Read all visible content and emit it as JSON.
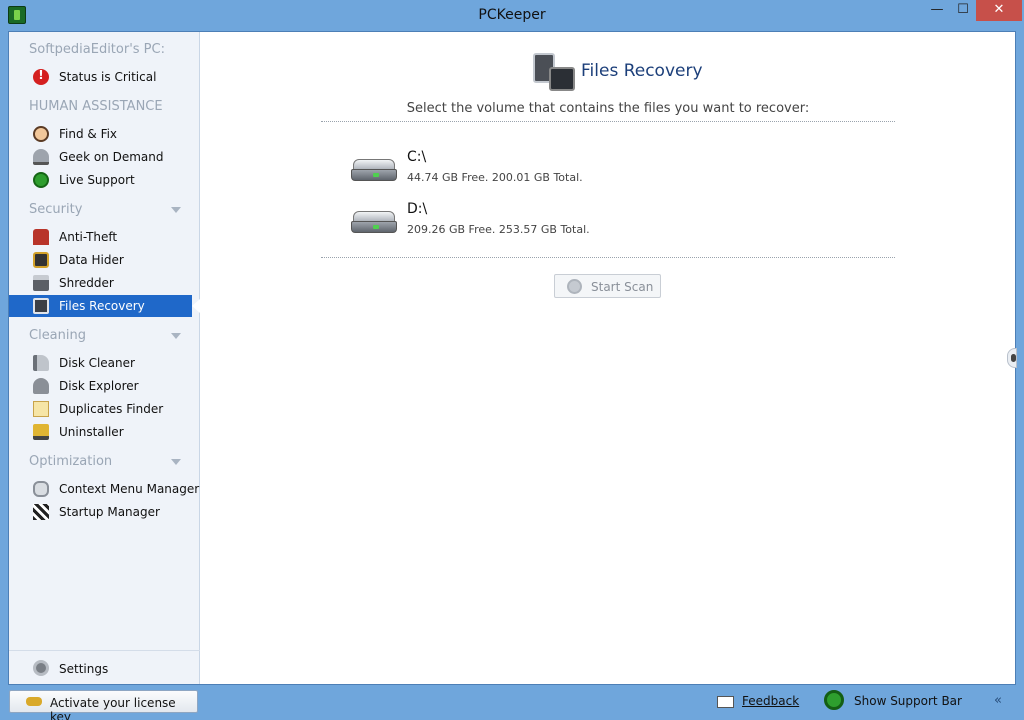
{
  "window": {
    "title": "PCKeeper",
    "minimize_glyph": "—",
    "maximize_glyph": "☐",
    "close_glyph": "✕"
  },
  "sidebar": {
    "pc_header": "SoftpediaEditor's PC:",
    "status_item": {
      "label": "Status is Critical",
      "icon": "critical-icon"
    },
    "human_header": "HUMAN ASSISTANCE",
    "human_items": [
      {
        "label": "Find & Fix",
        "icon": "person-icon"
      },
      {
        "label": "Geek on Demand",
        "icon": "bell-icon"
      },
      {
        "label": "Live Support",
        "icon": "headset-icon"
      }
    ],
    "security_header": "Security",
    "security_items": [
      {
        "label": "Anti-Theft",
        "icon": "anti-theft-icon"
      },
      {
        "label": "Data Hider",
        "icon": "data-hider-icon"
      },
      {
        "label": "Shredder",
        "icon": "shredder-icon"
      },
      {
        "label": "Files Recovery",
        "icon": "files-recovery-icon",
        "active": true
      }
    ],
    "cleaning_header": "Cleaning",
    "cleaning_items": [
      {
        "label": "Disk Cleaner",
        "icon": "disk-cleaner-icon"
      },
      {
        "label": "Disk Explorer",
        "icon": "disk-explorer-icon"
      },
      {
        "label": "Duplicates Finder",
        "icon": "duplicates-finder-icon"
      },
      {
        "label": "Uninstaller",
        "icon": "uninstaller-icon"
      }
    ],
    "optimization_header": "Optimization",
    "optimization_items": [
      {
        "label": "Context Menu Manager",
        "icon": "context-menu-icon"
      },
      {
        "label": "Startup Manager",
        "icon": "startup-manager-icon"
      }
    ],
    "settings_label": "Settings"
  },
  "main": {
    "title": "Files Recovery",
    "instruction": "Select the volume that contains the files you want to recover:",
    "volumes": [
      {
        "name": "C:\\",
        "info": "44.74 GB Free. 200.01 GB Total."
      },
      {
        "name": "D:\\",
        "info": "209.26 GB Free. 253.57 GB Total."
      }
    ],
    "scan_button": "Start Scan"
  },
  "bottom": {
    "license_button": "Activate your license key",
    "feedback_link": "Feedback",
    "support_button": "Show Support Bar",
    "collapse_glyph": "«"
  },
  "colors": {
    "frame": "#6fa6dc",
    "active_item": "#1f68c9",
    "title_blue": "#1c3f7a",
    "close_red": "#c7504a"
  }
}
